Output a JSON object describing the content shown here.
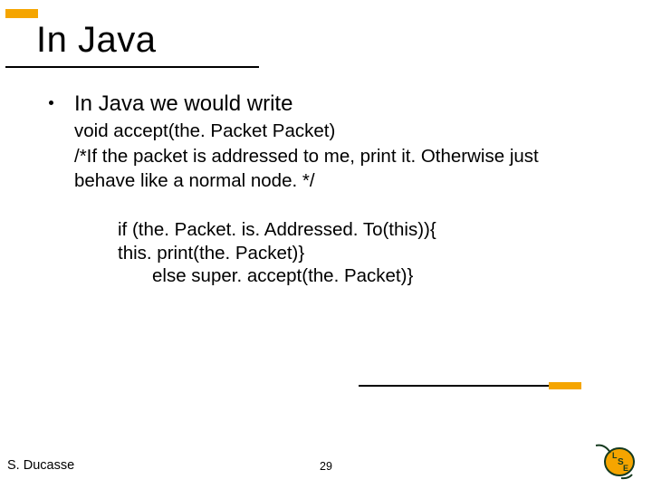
{
  "title": "In Java",
  "bullet": {
    "heading": "In Java we would write",
    "line1": "void accept(the. Packet Packet)",
    "line2": "/*If the packet is addressed to me, print it. Otherwise just",
    "line3": "behave like a normal node. */"
  },
  "code": {
    "l1": "if (the. Packet. is. Addressed. To(this)){",
    "l2": "this. print(the. Packet)}",
    "l3": "else super. accept(the. Packet)}"
  },
  "footer": {
    "author": "S. Ducasse",
    "page": "29"
  },
  "logo": {
    "textTop": "L",
    "textMid": "S",
    "textBot": "E"
  }
}
